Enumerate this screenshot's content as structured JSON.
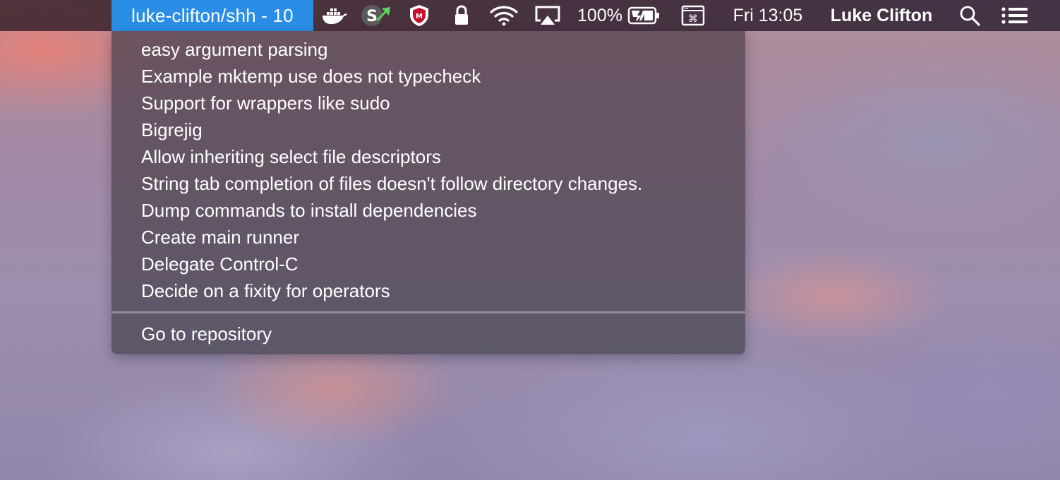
{
  "menubar": {
    "active_title": "luke-clifton/shh - 10",
    "battery_percent": "100%",
    "clock": "Fri 13:05",
    "user_name": "Luke Clifton",
    "icons": [
      "docker-whale-icon",
      "cash-app-icon",
      "mcafee-shield-icon",
      "lock-icon",
      "wifi-icon",
      "airplay-icon",
      "battery-charging-icon",
      "keyboard-shortcut-icon",
      "spotlight-search-icon",
      "notification-center-icon"
    ],
    "colors": {
      "active_highlight": "#2b8ee6",
      "mcafee_red": "#c8102e",
      "cash_green": "#5cd65c"
    }
  },
  "dropdown": {
    "items": [
      {
        "label": "easy argument parsing"
      },
      {
        "label": "Example mktemp use does not typecheck"
      },
      {
        "label": "Support for wrappers like sudo"
      },
      {
        "label": "Bigrejig"
      },
      {
        "label": "Allow inheriting select file descriptors"
      },
      {
        "label": "String tab completion of files doesn't follow directory changes."
      },
      {
        "label": "Dump commands to install dependencies"
      },
      {
        "label": "Create main runner"
      },
      {
        "label": "Delegate Control-C"
      },
      {
        "label": "Decide on a fixity for operators"
      }
    ],
    "footer_label": "Go to repository"
  }
}
